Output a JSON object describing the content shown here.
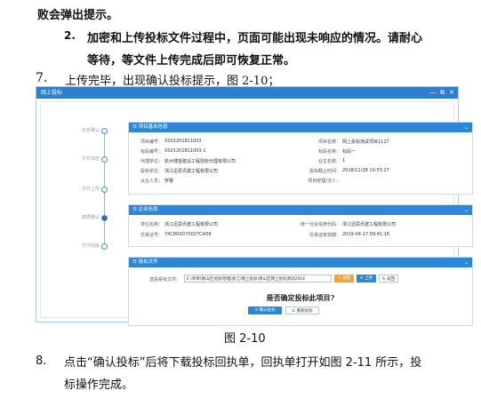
{
  "document": {
    "line1": "败会弹出提示。",
    "item2_num": "2.",
    "item2_line1": "加密和上传投标文件过程中，页面可能出现未响应的情况。请耐心",
    "item2_line2": "等待，等文件上传完成后即可恢复正常。",
    "item7_num": "7.",
    "item7_text": "上传完毕，出现确认投标提示，图 2-10；",
    "figure_caption": "图 2-10",
    "item8_num": "8.",
    "item8_line1": "点击“确认投标”后将下载投标回执单，回执单打开如图 2-11 所示，投",
    "item8_line2": "标操作完成。"
  },
  "window": {
    "title": "网上投标",
    "controls": [
      "—",
      "⧉",
      "✕"
    ],
    "steps": [
      {
        "label": "信息确认",
        "state": "done"
      },
      {
        "label": "文件加密",
        "state": "done"
      },
      {
        "label": "文件上传",
        "state": "done"
      },
      {
        "label": "数据确认",
        "state": "active"
      },
      {
        "label": "打印回执",
        "state": "todo"
      }
    ],
    "project_panel": {
      "title": "☰ 项目基本信息",
      "left": [
        {
          "label": "项目编号：",
          "value": "XS01201811003"
        },
        {
          "label": "标段编号：",
          "value": "XS01201811003-1"
        },
        {
          "label": "代理单位：",
          "value": "杭州博望建设工程招标代理有限公司"
        },
        {
          "label": "投标单位：",
          "value": "浙江迅思讯建工程有限公司"
        },
        {
          "label": "从业人员：",
          "value": "罗蕾"
        }
      ],
      "right": [
        {
          "label": "项目名称：",
          "value": "网上投标测试项目1127"
        },
        {
          "label": "标段名称：",
          "value": "标段一"
        },
        {
          "label": "业主名称：",
          "value": "1"
        },
        {
          "label": "投标截止时间：",
          "value": "2018/11/28 10:53:27"
        },
        {
          "label": "项目经理/法人：",
          "value": ""
        }
      ]
    },
    "company_panel": {
      "title": "☰ 企业信息",
      "left": [
        {
          "label": "单位名称：",
          "value": "浙江迅思讯建工程有限公司"
        },
        {
          "label": "交易证号：",
          "value": "74C800D70027CA59"
        }
      ],
      "right": [
        {
          "label": "统一社会信用代码：",
          "value": "浙江迅思讯建工程有限公司"
        },
        {
          "label": "交易证有效期：",
          "value": "2019-04-17 09:41:16"
        }
      ]
    },
    "bid_panel": {
      "title": "☰ 投标文件",
      "file_label": "选投投标文件：",
      "file_path": "E:\\项目\\萧山区\\招标管理\\浙江\\网上投标\\萧山区网上投标测试2018",
      "btn_encrypt": "✎ 加密",
      "btn_upload": "⊙ 上传",
      "btn_back": "↻ 返回",
      "question": "是否确定投标此项目?",
      "btn_confirm": "⊙ 确认投标",
      "btn_reselect": "↻ 重新投标"
    }
  }
}
